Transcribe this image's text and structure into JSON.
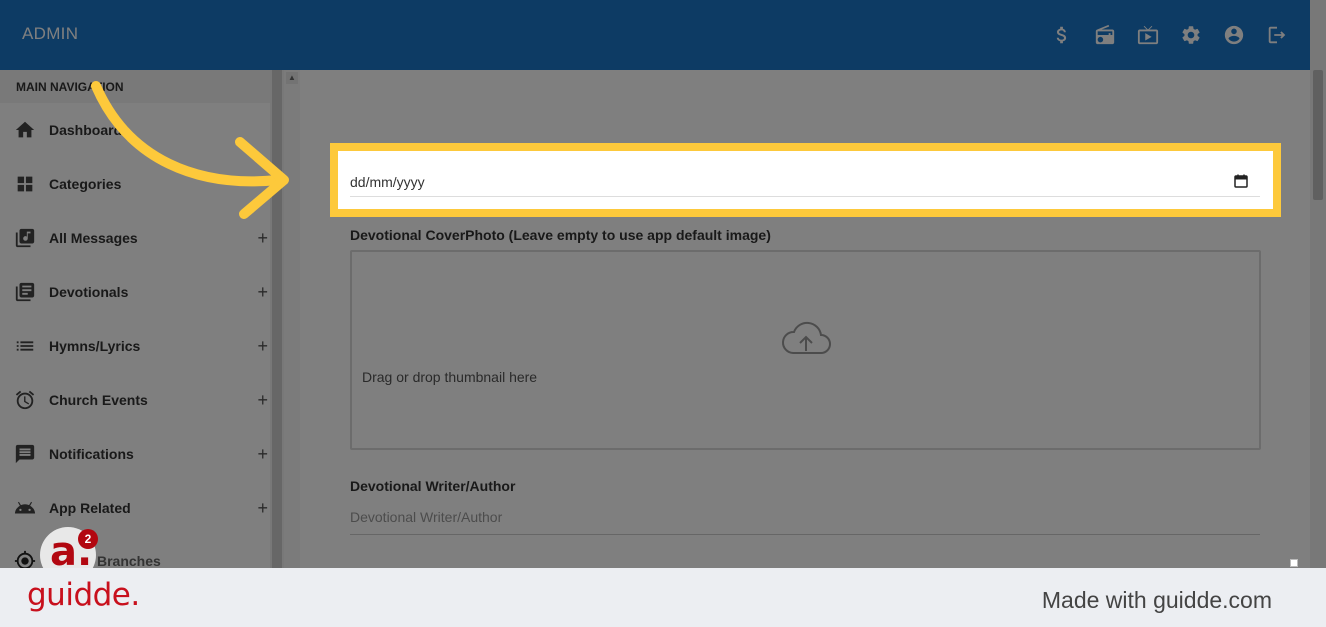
{
  "header": {
    "brand": "ADMIN",
    "icons": [
      "dollar-icon",
      "radio-icon",
      "live-tv-icon",
      "settings-icon",
      "account-icon",
      "logout-icon"
    ],
    "color": "#1a76c9"
  },
  "sidebar": {
    "title": "MAIN NAVIGATION",
    "items": [
      {
        "label": "Dashboard",
        "icon": "home-icon",
        "expandable": false
      },
      {
        "label": "Categories",
        "icon": "categories-icon",
        "expandable": false
      },
      {
        "label": "All Messages",
        "icon": "music-library-icon",
        "expandable": true
      },
      {
        "label": "Devotionals",
        "icon": "library-books-icon",
        "expandable": true
      },
      {
        "label": "Hymns/Lyrics",
        "icon": "list-icon",
        "expandable": true
      },
      {
        "label": "Church Events",
        "icon": "alarm-icon",
        "expandable": true
      },
      {
        "label": "Notifications",
        "icon": "message-icon",
        "expandable": true
      },
      {
        "label": "App Related",
        "icon": "android-icon",
        "expandable": true
      }
    ],
    "partial_item": {
      "label": "Branches",
      "icon": "target-icon"
    },
    "plus": "+"
  },
  "form": {
    "date_field": {
      "value": "dd/mm/yyyy"
    },
    "cover_photo": {
      "label": "Devotional CoverPhoto (Leave empty to use app default image)",
      "hint": "Drag or drop thumbnail here"
    },
    "writer": {
      "label": "Devotional Writer/Author",
      "placeholder": "Devotional Writer/Author"
    }
  },
  "avatar": {
    "letter": "a.",
    "badge": "2"
  },
  "footer": {
    "logo": "guidde.",
    "made_with": "Made with guidde.com"
  },
  "colors": {
    "highlight": "#fdc93b",
    "brand_red": "#c8101d"
  }
}
